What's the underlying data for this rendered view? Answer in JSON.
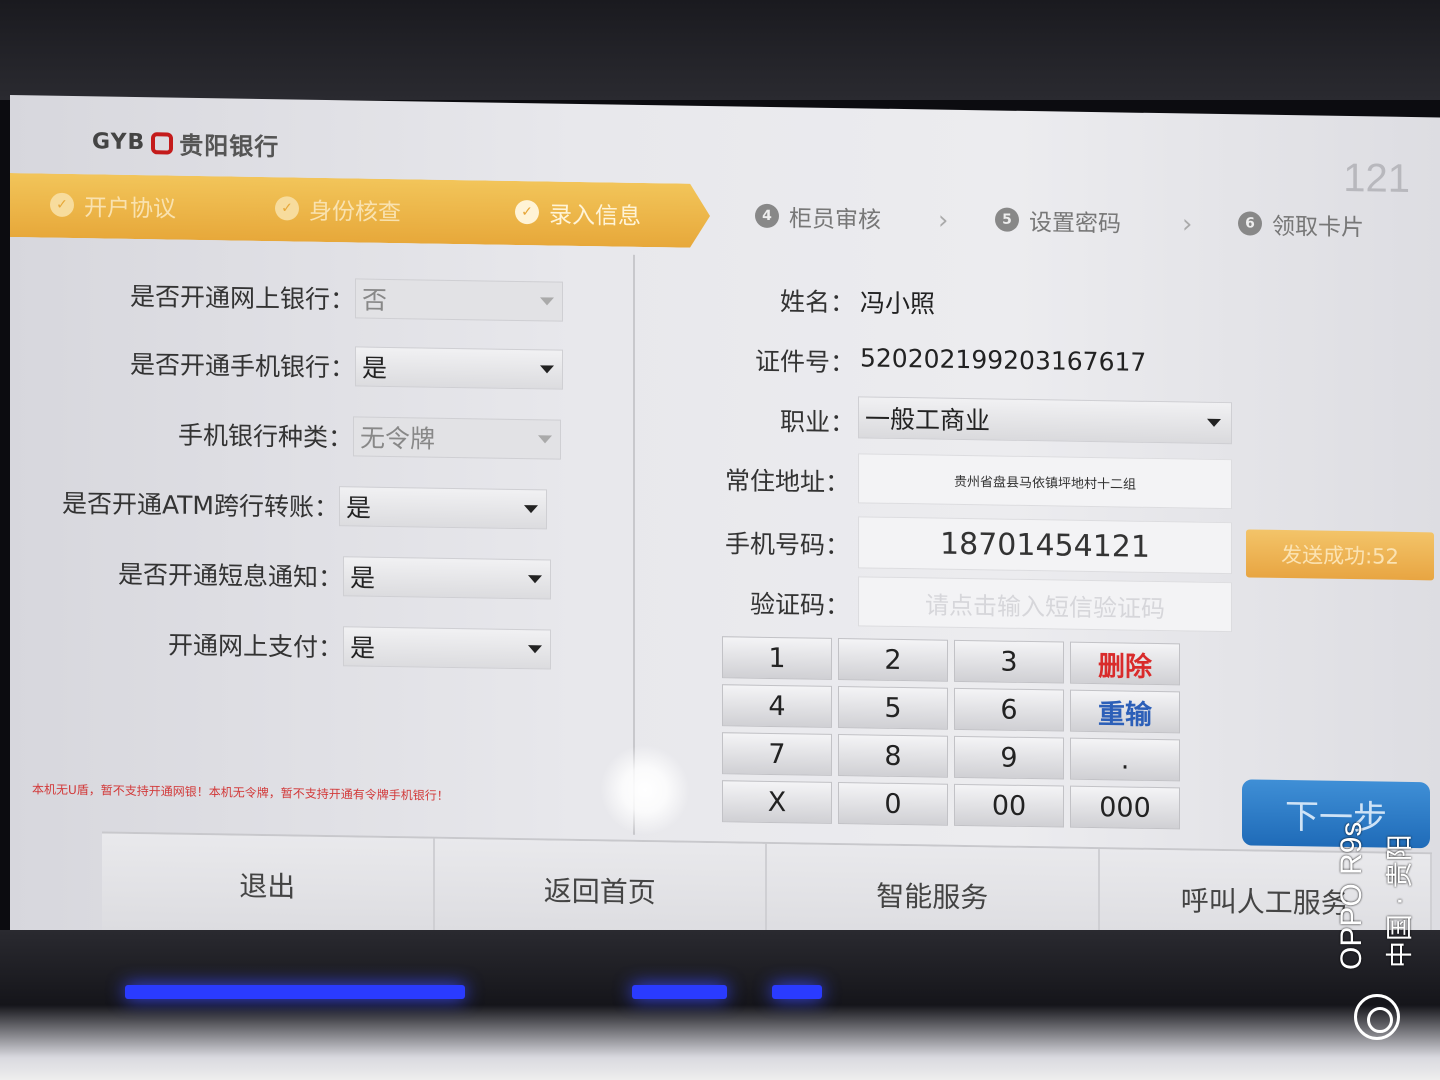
{
  "brand": {
    "code": "GYB",
    "name": "贵阳银行"
  },
  "counter": "121",
  "steps": [
    {
      "num": "1",
      "label": "开户协议",
      "state": "done"
    },
    {
      "num": "2",
      "label": "身份核查",
      "state": "done"
    },
    {
      "num": "3",
      "label": "录入信息",
      "state": "current"
    },
    {
      "num": "4",
      "label": "柜员审核",
      "state": "todo"
    },
    {
      "num": "5",
      "label": "设置密码",
      "state": "todo"
    },
    {
      "num": "6",
      "label": "领取卡片",
      "state": "todo"
    }
  ],
  "left_form": {
    "online_banking": {
      "label": "是否开通网上银行：",
      "value": "否"
    },
    "mobile_banking": {
      "label": "是否开通手机银行：",
      "value": "是"
    },
    "mobile_type": {
      "label": "手机银行种类：",
      "value": "无令牌"
    },
    "atm_transfer": {
      "label": "是否开通ATM跨行转账：",
      "value": "是"
    },
    "sms_notice": {
      "label": "是否开通短息通知：",
      "value": "是"
    },
    "online_pay": {
      "label": "开通网上支付：",
      "value": "是"
    },
    "warning": "本机无U盾，暂不支持开通网银！本机无令牌，暂不支持开通有令牌手机银行！"
  },
  "right_form": {
    "name": {
      "label": "姓名：",
      "value": "冯小照"
    },
    "id_number": {
      "label": "证件号：",
      "value": "520202199203167617"
    },
    "occupation": {
      "label": "职业：",
      "value": "一般工商业"
    },
    "address": {
      "label": "常住地址：",
      "value": "贵州省盘县马依镇坪地村十二组"
    },
    "phone": {
      "label": "手机号码：",
      "value": "18701454121"
    },
    "send_button": "发送成功:52",
    "code": {
      "label": "验证码：",
      "placeholder": "请点击输入短信验证码"
    }
  },
  "keypad": {
    "keys": [
      "1",
      "2",
      "3",
      "删除",
      "4",
      "5",
      "6",
      "重输",
      "7",
      "8",
      "9",
      ".",
      "X",
      "0",
      "00",
      "000"
    ]
  },
  "next_button": "下一步",
  "bottom_bar": [
    "退出",
    "返回首页",
    "智能服务",
    "呼叫人工服务"
  ],
  "watermark": {
    "device": "OPPO R9s",
    "location": "中国 · 贵阳"
  },
  "colors": {
    "progress": "#e7a83a",
    "accent_blue": "#1f6bb8",
    "delete_red": "#d92b2b",
    "brand_red": "#c41b1b"
  }
}
